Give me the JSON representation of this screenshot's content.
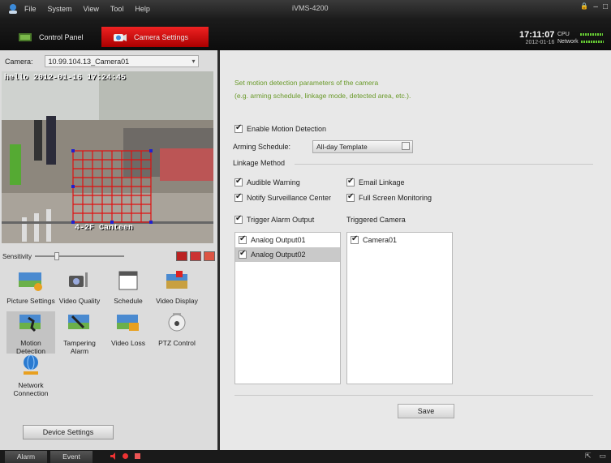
{
  "menu": [
    "File",
    "System",
    "View",
    "Tool",
    "Help"
  ],
  "window_title": "iVMS-4200",
  "window_controls": {
    "lock": "🔒",
    "minimize": "–",
    "close": "□"
  },
  "tabs": {
    "control_panel": "Control Panel",
    "camera_settings": "Camera Settings"
  },
  "clock": {
    "time": "17:11:07",
    "date": "2012-01-16"
  },
  "meters": {
    "cpu": "CPU",
    "network": "Network"
  },
  "camera": {
    "label": "Camera:",
    "value": "10.99.104.13_Camera01"
  },
  "video_osd": {
    "top": "hello 2012-01-16 17:24:45",
    "bottom": "4-2F Canteen"
  },
  "sensitivity_label": "Sensitivity",
  "settings_icons": [
    {
      "label": "Picture Settings",
      "icon": "picture-settings-icon"
    },
    {
      "label": "Video Quality",
      "icon": "video-quality-icon"
    },
    {
      "label": "Schedule",
      "icon": "schedule-icon"
    },
    {
      "label": "Video Display",
      "icon": "video-display-icon"
    },
    {
      "label": "Motion Detection",
      "icon": "motion-detection-icon"
    },
    {
      "label": "Tampering Alarm",
      "icon": "tampering-alarm-icon"
    },
    {
      "label": "Video Loss",
      "icon": "video-loss-icon"
    },
    {
      "label": "PTZ Control",
      "icon": "ptz-control-icon"
    },
    {
      "label": "Network Connection",
      "icon": "network-connection-icon"
    }
  ],
  "device_settings": "Device Settings",
  "hint": {
    "line1": "Set motion detection parameters of the camera",
    "line2": "(e.g. arming schedule, linkage mode, detected area, etc.)."
  },
  "enable_motion": "Enable Motion Detection",
  "arming_schedule": {
    "label": "Arming Schedule:",
    "value": "All-day Template"
  },
  "linkage_method": "Linkage Method",
  "linkage": {
    "audible": "Audible Warning",
    "email": "Email Linkage",
    "notify": "Notify Surveillance Center",
    "fullscreen": "Full Screen Monitoring"
  },
  "trigger_alarm_output": "Trigger Alarm Output",
  "triggered_camera": "Triggered Camera",
  "alarm_outputs": [
    "Analog Output01",
    "Analog Output02"
  ],
  "cameras": [
    "Camera01"
  ],
  "save": "Save",
  "status": {
    "alarm": "Alarm",
    "event": "Event"
  },
  "colors": {
    "accent_red": "#dd2222",
    "hint_green": "#6a9a2a",
    "panel_bg": "#e8e8e8"
  }
}
